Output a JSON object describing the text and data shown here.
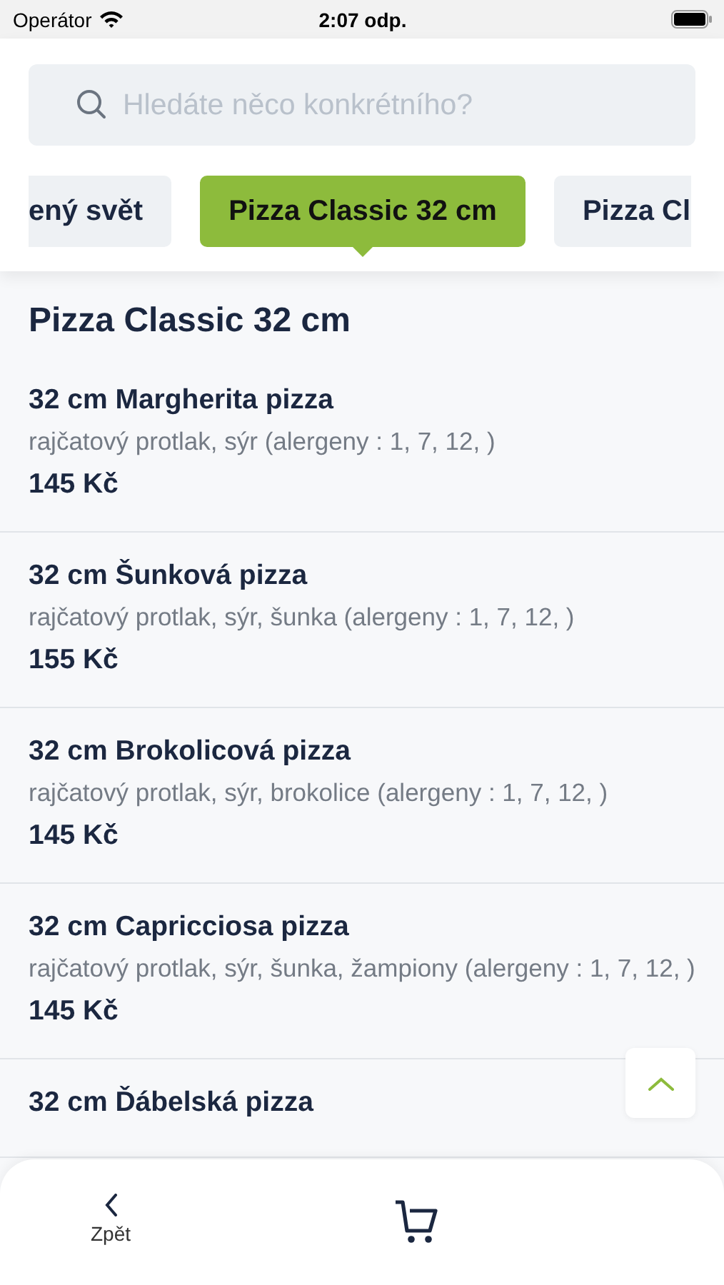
{
  "status_bar": {
    "carrier": "Operátor",
    "time": "2:07 odp."
  },
  "search": {
    "placeholder": "Hledáte něco konkrétního?"
  },
  "categories": [
    {
      "label": "ený svět",
      "selected": false
    },
    {
      "label": "Pizza Classic 32 cm",
      "selected": true
    },
    {
      "label": "Pizza Cl",
      "selected": false
    }
  ],
  "section_title": "Pizza Classic 32 cm",
  "items": [
    {
      "name": "32 cm Margherita pizza",
      "description": "rajčatový protlak, sýr (alergeny : 1, 7, 12, )",
      "price": "145 Kč"
    },
    {
      "name": "32 cm Šunková pizza",
      "description": "rajčatový protlak, sýr, šunka (alergeny : 1, 7, 12, )",
      "price": "155 Kč"
    },
    {
      "name": "32 cm Brokolicová pizza",
      "description": "rajčatový protlak, sýr, brokolice (alergeny : 1, 7, 12, )",
      "price": "145 Kč"
    },
    {
      "name": "32 cm Capricciosa pizza",
      "description": "rajčatový protlak, sýr, šunka, žampiony (alergeny : 1, 7, 12, )",
      "price": "145 Kč"
    },
    {
      "name": "32 cm Ďábelská pizza"
    }
  ],
  "bottom_bar": {
    "back_label": "Zpět"
  }
}
